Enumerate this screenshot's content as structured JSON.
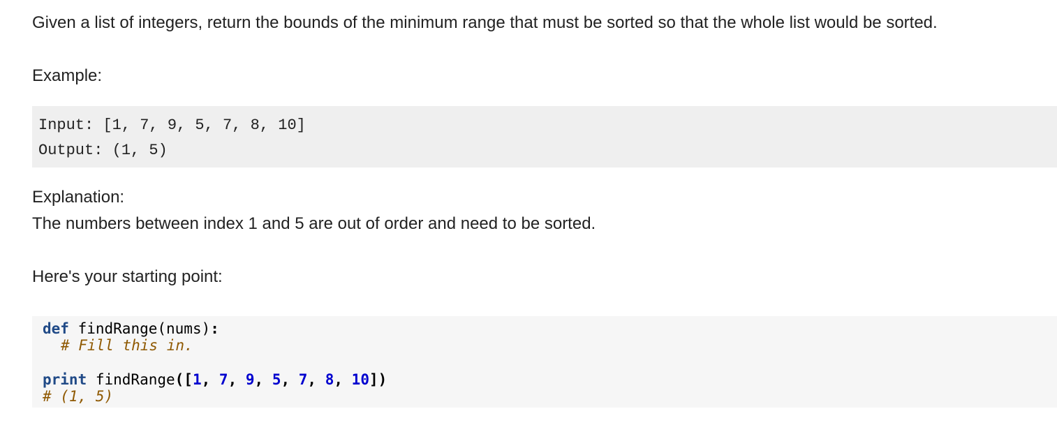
{
  "intro": "Given a list of integers, return the bounds of the minimum range that must be sorted so that the whole list would be sorted.",
  "example_heading": "Example:",
  "example": {
    "input_line": "Input: [1, 7, 9, 5, 7, 8, 10]",
    "output_line": "Output: (1, 5)"
  },
  "explanation_heading": "Explanation:",
  "explanation_text": "The numbers between index 1 and 5 are out of order and need to be sorted.",
  "starting_point_heading": "Here's your starting point:",
  "code": {
    "def_keyword": "def",
    "function_signature": " findRange(nums)",
    "colon": ":",
    "body_comment": "# Fill this in.",
    "print_keyword": "print",
    "call_name": " findRange",
    "call_open": "([",
    "call_args": [
      "1",
      "7",
      "9",
      "5",
      "7",
      "8",
      "10"
    ],
    "call_close": "])",
    "result_comment": "# (1, 5)"
  },
  "colors": {
    "keyword": "#204a87",
    "number": "#0000cf",
    "comment": "#8f5902",
    "example_bg": "#efefef",
    "code_bg": "#f6f6f6"
  }
}
